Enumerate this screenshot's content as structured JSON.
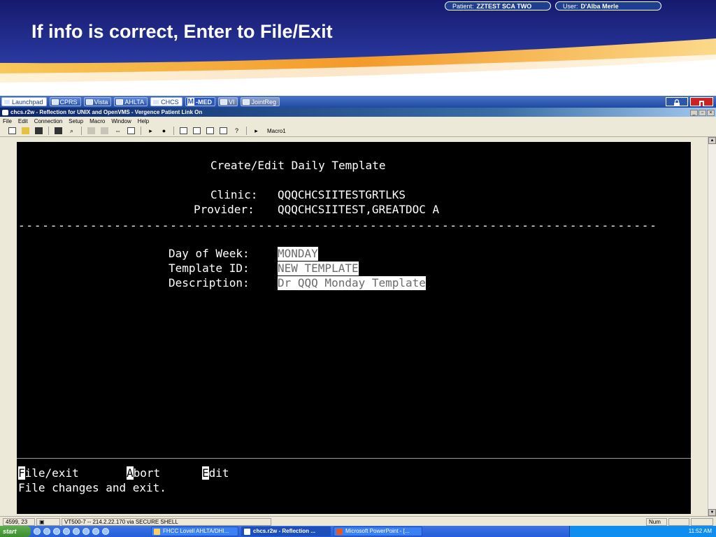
{
  "slide": {
    "title": "If info is correct, Enter to File/Exit",
    "colors": {
      "header_blue": "#1a1f7a",
      "swoosh_orange": "#f4a838"
    }
  },
  "launchpad": {
    "buttons": [
      {
        "label": "Launchpad",
        "active": true,
        "icon": "launchpad-icon"
      },
      {
        "label": "CPRS",
        "icon": "folder-icon"
      },
      {
        "label": "Vista",
        "icon": "vista-icon"
      },
      {
        "label": "AHLTA",
        "icon": "ahlta-icon"
      },
      {
        "label": "CHCS",
        "active": true,
        "icon": "chcs-icon"
      },
      {
        "label": "-MED",
        "prefix": "M",
        "icon": "mmed-icon"
      },
      {
        "label": "VI",
        "icon": "vi-icon"
      },
      {
        "label": "JointReg",
        "icon": "jointreg-icon"
      }
    ],
    "patient_label": "Patient:",
    "patient_name": "ZZTEST SCA TWO",
    "user_label": "User:",
    "user_name": "D'Alba Merle"
  },
  "window": {
    "title": "chcs.r2w - Reflection for UNIX and OpenVMS - Vergence Patient Link On",
    "menu": [
      "File",
      "Edit",
      "Connection",
      "Setup",
      "Macro",
      "Window",
      "Help"
    ],
    "macro_label": "Macro1"
  },
  "terminal": {
    "screen_title": "Create/Edit Daily Template",
    "clinic_label": "Clinic:",
    "clinic_value": "QQQCHCSIITESTGRTLKS",
    "provider_label": "Provider:",
    "provider_value": "QQQCHCSIITEST,GREATDOC A",
    "separator": "--------------------------------------------------------------------------------",
    "fields": {
      "day_label": "Day of Week:",
      "day_value": "MONDAY",
      "template_label": "Template ID:",
      "template_value": "NEW TEMPLATE",
      "description_label": "Description:",
      "description_value": "Dr QQQ Monday Template"
    },
    "actions": {
      "file_key": "F",
      "file_rest": "ile/exit",
      "abort_key": "A",
      "abort_rest": "bort",
      "edit_key": "E",
      "edit_rest": "dit"
    },
    "help_text": "File changes and exit."
  },
  "statusbar": {
    "position": "4599, 23",
    "connection": "VT500-7 -- 214.2.22.170 via SECURE SHELL",
    "num": "Num"
  },
  "taskbar": {
    "start": "start",
    "tasks": [
      "FHCC Lovell AHLTA/DHI...",
      "chcs.r2w - Reflection ...",
      "Microsoft PowerPoint - [..."
    ],
    "clock": "11:52 AM"
  }
}
